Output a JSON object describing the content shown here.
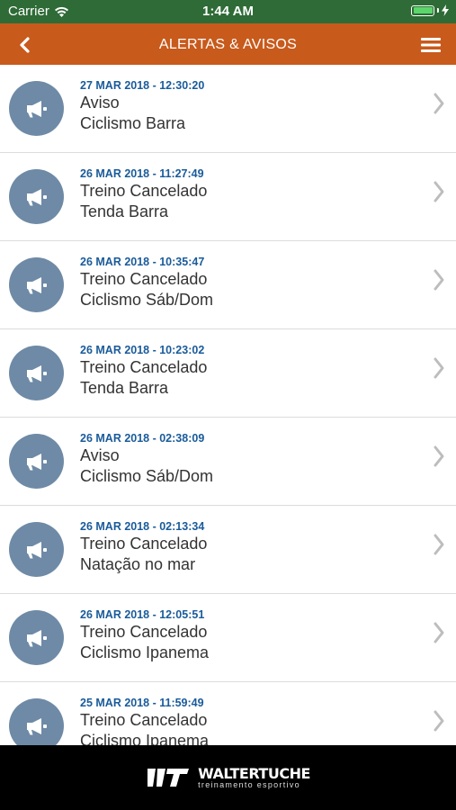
{
  "status_bar": {
    "carrier": "Carrier",
    "time": "1:44 AM"
  },
  "header": {
    "title": "ALERTAS & AVISOS",
    "back_icon": "chevron-left-icon",
    "menu_icon": "hamburger-menu-icon",
    "color": "#c85a1c"
  },
  "alerts": [
    {
      "date": "27 MAR 2018 - 12:30:20",
      "title": "Aviso",
      "subtitle": "Ciclismo Barra"
    },
    {
      "date": "26 MAR 2018 - 11:27:49",
      "title": "Treino Cancelado",
      "subtitle": "Tenda Barra"
    },
    {
      "date": "26 MAR 2018 - 10:35:47",
      "title": "Treino Cancelado",
      "subtitle": "Ciclismo Sáb/Dom"
    },
    {
      "date": "26 MAR 2018 - 10:23:02",
      "title": "Treino Cancelado",
      "subtitle": "Tenda Barra"
    },
    {
      "date": "26 MAR 2018 - 02:38:09",
      "title": "Aviso",
      "subtitle": "Ciclismo Sáb/Dom"
    },
    {
      "date": "26 MAR 2018 - 02:13:34",
      "title": "Treino Cancelado",
      "subtitle": "Natação no mar"
    },
    {
      "date": "26 MAR 2018 - 12:05:51",
      "title": "Treino Cancelado",
      "subtitle": "Ciclismo Ipanema"
    },
    {
      "date": "25 MAR 2018 - 11:59:49",
      "title": "Treino Cancelado",
      "subtitle": "Ciclismo Ipanema"
    }
  ],
  "footer": {
    "brand": "WALTERTUCHE",
    "tagline": "treinamento esportivo"
  }
}
